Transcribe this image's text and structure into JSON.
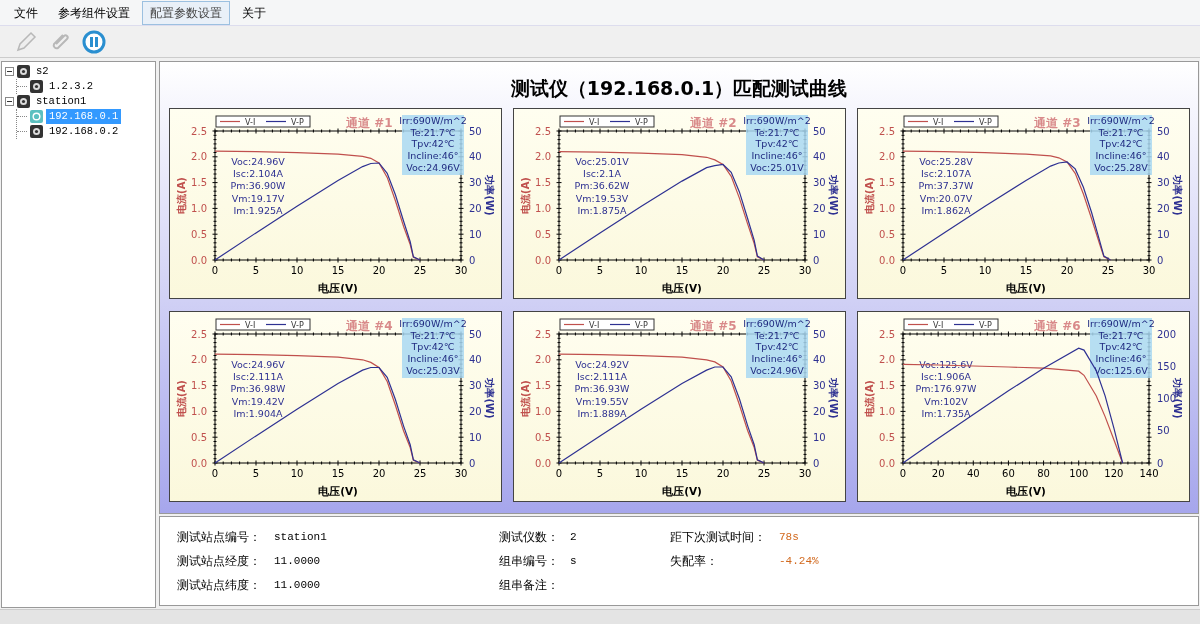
{
  "menu": [
    {
      "label": "文件",
      "selected": false
    },
    {
      "label": "参考组件设置",
      "selected": false
    },
    {
      "label": "配置参数设置",
      "selected": true
    },
    {
      "label": "关于",
      "selected": false
    }
  ],
  "toolbar": [
    {
      "kind": "edit",
      "disabled": true
    },
    {
      "kind": "attach",
      "disabled": true
    },
    {
      "kind": "pause",
      "disabled": false
    }
  ],
  "tree": [
    {
      "label": "s2",
      "expanded": true,
      "selected": false,
      "children": [
        {
          "label": "1.2.3.2",
          "selected": false
        }
      ]
    },
    {
      "label": "station1",
      "expanded": true,
      "selected": false,
      "children": [
        {
          "label": "192.168.0.1",
          "selected": true
        },
        {
          "label": "192.168.0.2",
          "selected": false
        }
      ]
    }
  ],
  "panel": {
    "title": "测试仪（192.168.0.1）匹配测试曲线",
    "charts": [
      {
        "channel": "通道 #1",
        "info": [
          "Irr:690W/m^2",
          "Te:21.7℃",
          "Tpv:42℃",
          "Incline:46°",
          "Voc:24.96V"
        ],
        "params": [
          "Voc:24.96V",
          "Isc:2.104A",
          "Pm:36.90W",
          "Vm:19.17V",
          "Im:1.925A"
        ],
        "chart_data": {
          "type": "line",
          "legend": "upper left",
          "xlabel": "电压(V)",
          "ylabel": "电流(A)",
          "y2label": "功率(W)",
          "xlim": [
            0,
            30
          ],
          "ylim": [
            0,
            2.5
          ],
          "y2lim": [
            0,
            50
          ],
          "xticks": [
            0,
            5,
            10,
            15,
            20,
            25,
            30
          ],
          "yticks": [
            {
              "value": 0,
              "label": "0.0"
            },
            {
              "value": 0.5,
              "label": "0.5"
            },
            {
              "value": 1,
              "label": "1.0"
            },
            {
              "value": 1.5,
              "label": "1.5"
            },
            {
              "value": 2,
              "label": "2.0"
            },
            {
              "value": 2.5,
              "label": "2.5"
            }
          ],
          "y2ticks": [
            0,
            10,
            20,
            30,
            40,
            50
          ],
          "x": [
            0,
            5,
            10,
            15,
            18,
            19,
            20,
            21,
            22,
            23,
            23.8,
            24.2,
            25
          ],
          "series": [
            {
              "name": "V-I",
              "color": "#c0504d",
              "values": [
                2.11,
                2.1,
                2.08,
                2.05,
                2.01,
                1.97,
                1.88,
                1.6,
                1.15,
                0.65,
                0.3,
                0.05,
                0
              ]
            },
            {
              "name": "V-P",
              "color": "#2e3192",
              "axis": "y2",
              "values": [
                0,
                10.5,
                20.8,
                30.8,
                36.2,
                37.4,
                37.6,
                33.6,
                25.3,
                15,
                7.1,
                1.2,
                0
              ]
            }
          ]
        }
      },
      {
        "channel": "通道 #2",
        "info": [
          "Irr:690W/m^2",
          "Te:21.7℃",
          "Tpv:42℃",
          "Incline:46°",
          "Voc:25.01V"
        ],
        "params": [
          "Voc:25.01V",
          "Isc:2.1A",
          "Pm:36.62W",
          "Vm:19.53V",
          "Im:1.875A"
        ],
        "chart_data": {
          "type": "line",
          "legend": "upper left",
          "xlabel": "电压(V)",
          "ylabel": "电流(A)",
          "y2label": "功率(W)",
          "xlim": [
            0,
            30
          ],
          "ylim": [
            0,
            2.5
          ],
          "y2lim": [
            0,
            50
          ],
          "xticks": [
            0,
            5,
            10,
            15,
            20,
            25,
            30
          ],
          "yticks": [
            {
              "value": 0,
              "label": "0.0"
            },
            {
              "value": 0.5,
              "label": "0.5"
            },
            {
              "value": 1,
              "label": "1.0"
            },
            {
              "value": 1.5,
              "label": "1.5"
            },
            {
              "value": 2,
              "label": "2.0"
            },
            {
              "value": 2.5,
              "label": "2.5"
            }
          ],
          "y2ticks": [
            0,
            10,
            20,
            30,
            40,
            50
          ],
          "x": [
            0,
            5,
            10,
            15,
            18,
            19,
            20,
            21,
            22,
            23,
            23.8,
            24.2,
            25
          ],
          "series": [
            {
              "name": "V-I",
              "color": "#c0504d",
              "values": [
                2.1,
                2.09,
                2.07,
                2.04,
                1.99,
                1.94,
                1.85,
                1.62,
                1.2,
                0.7,
                0.32,
                0.06,
                0
              ]
            },
            {
              "name": "V-P",
              "color": "#2e3192",
              "axis": "y2",
              "values": [
                0,
                10.5,
                20.7,
                30.6,
                35.8,
                36.6,
                37,
                34,
                26.4,
                16.1,
                7.6,
                1.5,
                0
              ]
            }
          ]
        }
      },
      {
        "channel": "通道 #3",
        "info": [
          "Irr:690W/m^2",
          "Te:21.7℃",
          "Tpv:42℃",
          "Incline:46°",
          "Voc:25.28V"
        ],
        "params": [
          "Voc:25.28V",
          "Isc:2.107A",
          "Pm:37.37W",
          "Vm:20.07V",
          "Im:1.862A"
        ],
        "chart_data": {
          "type": "line",
          "legend": "upper left",
          "xlabel": "电压(V)",
          "ylabel": "电流(A)",
          "y2label": "功率(W)",
          "xlim": [
            0,
            30
          ],
          "ylim": [
            0,
            2.5
          ],
          "y2lim": [
            0,
            50
          ],
          "xticks": [
            0,
            5,
            10,
            15,
            20,
            25,
            30
          ],
          "yticks": [
            {
              "value": 0,
              "label": "0.0"
            },
            {
              "value": 0.5,
              "label": "0.5"
            },
            {
              "value": 1,
              "label": "1.0"
            },
            {
              "value": 1.5,
              "label": "1.5"
            },
            {
              "value": 2,
              "label": "2.0"
            },
            {
              "value": 2.5,
              "label": "2.5"
            }
          ],
          "y2ticks": [
            0,
            10,
            20,
            30,
            40,
            50
          ],
          "x": [
            0,
            5,
            10,
            15,
            18,
            19,
            20,
            21,
            22,
            23,
            24,
            24.5,
            25.3
          ],
          "series": [
            {
              "name": "V-I",
              "color": "#c0504d",
              "values": [
                2.11,
                2.1,
                2.08,
                2.05,
                2.02,
                1.98,
                1.9,
                1.68,
                1.28,
                0.8,
                0.3,
                0.06,
                0
              ]
            },
            {
              "name": "V-P",
              "color": "#2e3192",
              "axis": "y2",
              "values": [
                0,
                10.5,
                20.8,
                30.8,
                36.4,
                37.6,
                38,
                35.3,
                28.2,
                18.4,
                7.2,
                1.5,
                0
              ]
            }
          ]
        }
      },
      {
        "channel": "通道 #4",
        "info": [
          "Irr:690W/m^2",
          "Te:21.7℃",
          "Tpv:42℃",
          "Incline:46°",
          "Voc:25.03V"
        ],
        "params": [
          "Voc:24.96V",
          "Isc:2.111A",
          "Pm:36.98W",
          "Vm:19.42V",
          "Im:1.904A"
        ],
        "chart_data": {
          "type": "line",
          "legend": "upper left",
          "xlabel": "电压(V)",
          "ylabel": "电流(A)",
          "y2label": "功率(W)",
          "xlim": [
            0,
            30
          ],
          "ylim": [
            0,
            2.5
          ],
          "y2lim": [
            0,
            50
          ],
          "xticks": [
            0,
            5,
            10,
            15,
            20,
            25,
            30
          ],
          "yticks": [
            {
              "value": 0,
              "label": "0.0"
            },
            {
              "value": 0.5,
              "label": "0.5"
            },
            {
              "value": 1,
              "label": "1.0"
            },
            {
              "value": 1.5,
              "label": "1.5"
            },
            {
              "value": 2,
              "label": "2.0"
            },
            {
              "value": 2.5,
              "label": "2.5"
            }
          ],
          "y2ticks": [
            0,
            10,
            20,
            30,
            40,
            50
          ],
          "x": [
            0,
            5,
            10,
            15,
            18,
            19,
            20,
            21,
            22,
            23,
            23.8,
            24.2,
            25
          ],
          "series": [
            {
              "name": "V-I",
              "color": "#c0504d",
              "values": [
                2.11,
                2.1,
                2.08,
                2.05,
                2.0,
                1.95,
                1.85,
                1.58,
                1.12,
                0.62,
                0.3,
                0.05,
                0
              ]
            },
            {
              "name": "V-P",
              "color": "#2e3192",
              "axis": "y2",
              "values": [
                0,
                10.5,
                20.8,
                30.8,
                36,
                37,
                37,
                33.2,
                24.6,
                14.3,
                7.1,
                1.2,
                0
              ]
            }
          ]
        }
      },
      {
        "channel": "通道 #5",
        "info": [
          "Irr:690W/m^2",
          "Te:21.7℃",
          "Tpv:42℃",
          "Incline:46°",
          "Voc:24.96V"
        ],
        "params": [
          "Voc:24.92V",
          "Isc:2.111A",
          "Pm:36.93W",
          "Vm:19.55V",
          "Im:1.889A"
        ],
        "chart_data": {
          "type": "line",
          "legend": "upper left",
          "xlabel": "电压(V)",
          "ylabel": "电流(A)",
          "y2label": "功率(W)",
          "xlim": [
            0,
            30
          ],
          "ylim": [
            0,
            2.5
          ],
          "y2lim": [
            0,
            50
          ],
          "xticks": [
            0,
            5,
            10,
            15,
            20,
            25,
            30
          ],
          "yticks": [
            {
              "value": 0,
              "label": "0.0"
            },
            {
              "value": 0.5,
              "label": "0.5"
            },
            {
              "value": 1,
              "label": "1.0"
            },
            {
              "value": 1.5,
              "label": "1.5"
            },
            {
              "value": 2,
              "label": "2.0"
            },
            {
              "value": 2.5,
              "label": "2.5"
            }
          ],
          "y2ticks": [
            0,
            10,
            20,
            30,
            40,
            50
          ],
          "x": [
            0,
            5,
            10,
            15,
            18,
            19,
            20,
            21,
            22,
            23,
            23.8,
            24.2,
            25
          ],
          "series": [
            {
              "name": "V-I",
              "color": "#c0504d",
              "values": [
                2.11,
                2.1,
                2.08,
                2.05,
                2.0,
                1.96,
                1.86,
                1.59,
                1.13,
                0.63,
                0.3,
                0.05,
                0
              ]
            },
            {
              "name": "V-P",
              "color": "#2e3192",
              "axis": "y2",
              "values": [
                0,
                10.5,
                20.8,
                30.8,
                36,
                37.2,
                37.2,
                33.4,
                24.9,
                14.5,
                7.1,
                1.2,
                0
              ]
            }
          ]
        }
      },
      {
        "channel": "通道 #6",
        "info": [
          "Irr:690W/m^2",
          "Te:21.7℃",
          "Tpv:42℃",
          "Incline:46°",
          "Voc:125.6V"
        ],
        "params": [
          "Voc:125.6V",
          "Isc:1.906A",
          "Pm:176.97W",
          "Vm:102V",
          "Im:1.735A"
        ],
        "chart_data": {
          "type": "line",
          "legend": "upper left",
          "xlabel": "电压(V)",
          "ylabel": "电流(A)",
          "y2label": "功率(W)",
          "xlim": [
            0,
            140
          ],
          "ylim": [
            0,
            2.5
          ],
          "y2lim": [
            0,
            200
          ],
          "xticks": [
            0,
            20,
            40,
            60,
            80,
            100,
            120,
            140
          ],
          "yticks": [
            {
              "value": 0,
              "label": "0.0"
            },
            {
              "value": 0.5,
              "label": "0.5"
            },
            {
              "value": 1,
              "label": "1.0"
            },
            {
              "value": 1.5,
              "label": "1.5"
            },
            {
              "value": 2,
              "label": "2.0"
            },
            {
              "value": 2.5,
              "label": "2.5"
            }
          ],
          "y2ticks": [
            0,
            50,
            100,
            150,
            200
          ],
          "x": [
            0,
            20,
            40,
            60,
            80,
            100,
            103,
            110,
            115,
            120,
            125
          ],
          "series": [
            {
              "name": "V-I",
              "color": "#c0504d",
              "values": [
                1.91,
                1.9,
                1.88,
                1.86,
                1.84,
                1.78,
                1.7,
                1.3,
                0.9,
                0.45,
                0
              ]
            },
            {
              "name": "V-P",
              "color": "#2e3192",
              "axis": "y2",
              "values": [
                0,
                38,
                75,
                112,
                147,
                178,
                175,
                143,
                104,
                54,
                0
              ]
            }
          ]
        }
      }
    ]
  },
  "info_columns": [
    [
      {
        "label": "测试站点编号：",
        "value": "station1",
        "highlighted": false
      },
      {
        "label": "测试站点经度：",
        "value": "11.0000",
        "highlighted": false
      },
      {
        "label": "测试站点纬度：",
        "value": "11.0000",
        "highlighted": false
      }
    ],
    [
      {
        "label": "测试仪数：",
        "value": "2",
        "highlighted": false
      },
      {
        "label": "组串编号：",
        "value": "s",
        "highlighted": false
      },
      {
        "label": "组串备注："
      }
    ],
    [
      {
        "label": "距下次测试时间：",
        "value": "78s",
        "highlighted": true
      },
      {
        "label": "失配率：",
        "value": "-4.24%",
        "highlighted": true
      }
    ]
  ]
}
